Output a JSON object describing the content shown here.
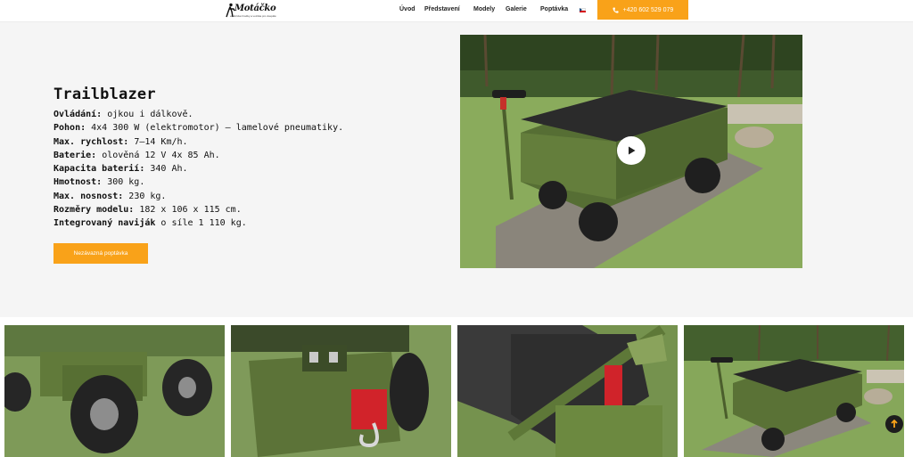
{
  "header": {
    "logo_text": "Motáčko",
    "logo_tagline": "elektrické hračky a vozítka pro dospělé",
    "nav": [
      "Úvod",
      "Představení",
      "Modely",
      "Galerie",
      "Poptávka"
    ],
    "language_flag": "czech-flag-icon",
    "phone": "+420 602 529 079",
    "phone_icon": "phone-icon",
    "accent_color": "#f9a219"
  },
  "hero": {
    "title": "Trailblazer",
    "specs": [
      {
        "label": "Ovládání:",
        "value": " ojkou i dálkově."
      },
      {
        "label": "Pohon:",
        "value": " 4x4 300 W (elektromotor) – lamelové pneumatiky."
      },
      {
        "label": "Max. rychlost:",
        "value": " 7–14 Km/h."
      },
      {
        "label": "Baterie:",
        "value": " olověná 12 V 4x 85 Ah."
      },
      {
        "label": "Kapacita baterií:",
        "value": " 340 Ah."
      },
      {
        "label": "Hmotnost:",
        "value": " 300 kg."
      },
      {
        "label": "Max. nosnost:",
        "value": " 230 kg."
      },
      {
        "label": "Rozměry modelu:",
        "value": " 182 x 106 x 115 cm."
      },
      {
        "label": "Integrovaný naviják",
        "value": " o síle 1 110 kg."
      }
    ],
    "cta_label": "Nezávazná poptávka",
    "video_play_icon": "play-icon"
  },
  "gallery": {
    "images": [
      "wheel-closeup-photo",
      "winch-closeup-photo",
      "battery-tray-photo",
      "vehicle-overview-photo"
    ]
  },
  "scroll_top_icon": "arrow-up-icon"
}
